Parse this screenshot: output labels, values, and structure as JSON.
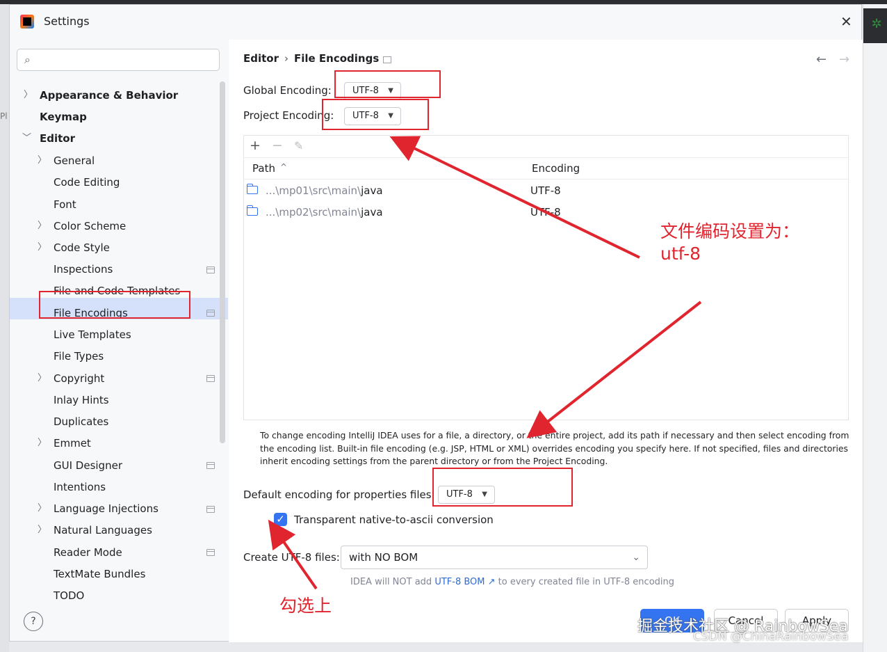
{
  "window": {
    "title": "Settings"
  },
  "background": {
    "left_fragment": "Pl"
  },
  "sidebar": {
    "search_placeholder": "",
    "items": [
      {
        "label": "Appearance & Behavior"
      },
      {
        "label": "Keymap"
      },
      {
        "label": "Editor"
      },
      {
        "label": "General"
      },
      {
        "label": "Code Editing"
      },
      {
        "label": "Font"
      },
      {
        "label": "Color Scheme"
      },
      {
        "label": "Code Style"
      },
      {
        "label": "Inspections"
      },
      {
        "label": "File and Code Templates"
      },
      {
        "label": "File Encodings"
      },
      {
        "label": "Live Templates"
      },
      {
        "label": "File Types"
      },
      {
        "label": "Copyright"
      },
      {
        "label": "Inlay Hints"
      },
      {
        "label": "Duplicates"
      },
      {
        "label": "Emmet"
      },
      {
        "label": "GUI Designer"
      },
      {
        "label": "Intentions"
      },
      {
        "label": "Language Injections"
      },
      {
        "label": "Natural Languages"
      },
      {
        "label": "Reader Mode"
      },
      {
        "label": "TextMate Bundles"
      },
      {
        "label": "TODO"
      }
    ],
    "selected": "File Encodings",
    "help_label": "?"
  },
  "main": {
    "breadcrumb": {
      "parent": "Editor",
      "separator": "›",
      "current": "File Encodings"
    },
    "nav": {
      "back": "←",
      "forward": "→"
    },
    "global_encoding": {
      "label": "Global Encoding:",
      "value": "UTF-8"
    },
    "project_encoding": {
      "label": "Project Encoding:",
      "value": "UTF-8"
    },
    "toolbar": {
      "add": "+",
      "remove": "−",
      "edit": "✎"
    },
    "table": {
      "columns": [
        "Path",
        "Encoding"
      ],
      "sort_indicator": "^",
      "rows": [
        {
          "path_prefix": "...\\mp01\\src\\main\\",
          "path_leaf": "java",
          "encoding": "UTF-8"
        },
        {
          "path_prefix": "...\\mp02\\src\\main\\",
          "path_leaf": "java",
          "encoding": "UTF-8"
        }
      ]
    },
    "hint_text": "To change encoding IntelliJ IDEA uses for a file, a directory, or the entire project, add its path if necessary and then select encoding from the encoding list. Built-in file encoding (e.g. JSP, HTML or XML) overrides encoding you specify here. If not specified, files and directories inherit encoding settings from the parent directory or from the Project Encoding.",
    "properties_encoding": {
      "label": "Default encoding for properties files:",
      "value": "UTF-8"
    },
    "native_to_ascii": {
      "label": "Transparent native-to-ascii conversion",
      "checked": true
    },
    "create_utf8": {
      "label": "Create UTF-8 files:",
      "value": "with NO BOM"
    },
    "bom_note": {
      "prefix": "IDEA will NOT add",
      "link": "UTF-8 BOM ↗",
      "suffix": "to every created file in UTF-8 encoding"
    },
    "buttons": {
      "ok": "OK",
      "cancel": "Cancel",
      "apply": "Apply"
    }
  },
  "annotations": {
    "encoding_note_line1": "文件编码设置为：",
    "encoding_note_line2": "utf-8",
    "check_note": "勾选上",
    "color": "#e0252f"
  },
  "watermarks": {
    "primary": "掘金技术社区 @ RainbowSea",
    "secondary": "CSDN @ChinaRainbowSea"
  }
}
